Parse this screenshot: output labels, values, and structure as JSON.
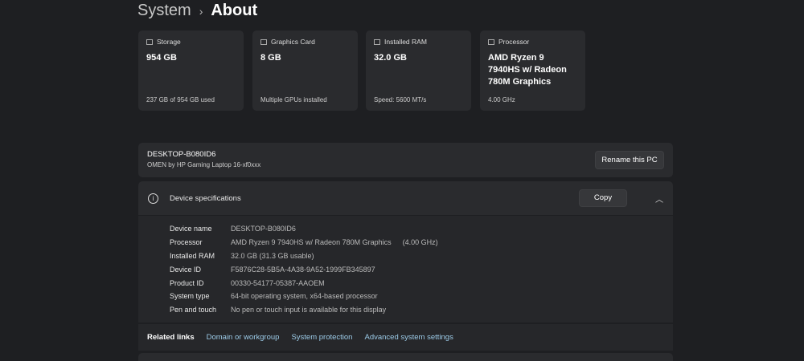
{
  "header": {
    "section": "System",
    "page": "About"
  },
  "cards": [
    {
      "label": "Storage",
      "value": "954 GB",
      "sub": "237 GB of 954 GB used",
      "icon": "storage-icon"
    },
    {
      "label": "Graphics Card",
      "value": "8 GB",
      "sub": "Multiple GPUs installed",
      "icon": "graphics-card-icon"
    },
    {
      "label": "Installed RAM",
      "value": "32.0 GB",
      "sub": "Speed: 5600 MT/s",
      "icon": "ram-icon"
    },
    {
      "label": "Processor",
      "value": "AMD Ryzen 9 7940HS w/ Radeon 780M Graphics",
      "sub": "4.00 GHz",
      "icon": "processor-icon"
    }
  ],
  "pc": {
    "name": "DESKTOP-B080ID6",
    "model": "OMEN by HP Gaming Laptop 16-xf0xxx",
    "rename_label": "Rename this PC"
  },
  "specs": {
    "title": "Device specifications",
    "copy_label": "Copy",
    "rows": [
      {
        "k": "Device name",
        "v": "DESKTOP-B080ID6"
      },
      {
        "k": "Processor",
        "v": "AMD Ryzen 9 7940HS w/ Radeon 780M Graphics",
        "extra": "(4.00 GHz)"
      },
      {
        "k": "Installed RAM",
        "v": "32.0 GB (31.3 GB usable)"
      },
      {
        "k": "Device ID",
        "v": "F5876C28-5B5A-4A38-9A52-1999FB345897"
      },
      {
        "k": "Product ID",
        "v": "00330-54177-05387-AAOEM"
      },
      {
        "k": "System type",
        "v": "64-bit operating system, x64-based processor"
      },
      {
        "k": "Pen and touch",
        "v": "No pen or touch input is available for this display"
      }
    ]
  },
  "related": {
    "label": "Related links",
    "links": [
      "Domain or workgroup",
      "System protection",
      "Advanced system settings"
    ]
  }
}
